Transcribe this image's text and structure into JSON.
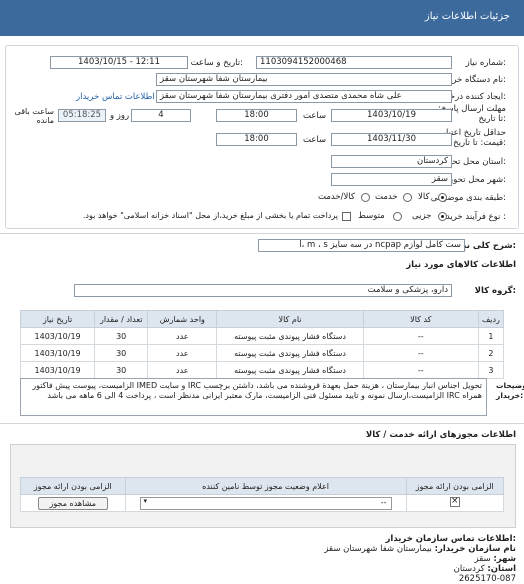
{
  "header": {
    "title": "جزئیات اطلاعات نیاز"
  },
  "form": {
    "need_number_label": "شماره نیاز:",
    "need_number": "1103094152000468",
    "announce_label": "تاریخ و ساعت اعلان عمومی:",
    "announce_value": "1403/10/15 - 12:11",
    "buyer_label": "نام دستگاه خریدار:",
    "buyer_value": "بیمارستان شفا شهرستان سقز",
    "creator_label": "ایجاد کننده درخواست:",
    "creator_value": "علی شاه محمدی متصدی امور دفتری بیمارستان شفا شهرستان سقز",
    "contact_link": "اطلاعات تماس خریدار",
    "reply_deadline_label": "مهلت ارسال پاسخ: تا تاریخ:",
    "reply_date": "1403/10/19",
    "time_label": "ساعت",
    "reply_time": "18:00",
    "days_value": "4",
    "days_label": "روز و",
    "remaining_time": "05:18:25",
    "remaining_label": "ساعت باقی مانده",
    "validity_label": "حداقل تاریخ اعتبار قیمت: تا تاریخ:",
    "validity_date": "1403/11/30",
    "validity_time": "18:00",
    "province_label": "استان محل تحویل:",
    "province_value": "کردستان",
    "city_label": "شهر محل تحویل:",
    "city_value": "سقز",
    "category_label": "طبقه بندی موضوعی:",
    "category_options": [
      "کالا",
      "خدمت",
      "کالا/خدمت"
    ],
    "category_selected": "کالا",
    "process_label": "نوع فرآیند خرید :",
    "process_options": [
      "جزیی",
      "متوسط"
    ],
    "process_selected": "جزیی",
    "payment_note": "پرداخت تمام یا بخشی از مبلغ خرید،از محل \"اسناد خزانه اسلامی\" خواهد بود."
  },
  "summary": {
    "label": "شرح کلی نیاز:",
    "value": "ست کامل لوازم ncpap در سه سایز l، m ، s"
  },
  "goods": {
    "section_title": "اطلاعات کالاهای مورد نیاز",
    "group_label": "گروه کالا:",
    "group_value": "دارو، پزشکی و سلامت",
    "columns": [
      "ردیف",
      "کد کالا",
      "نام کالا",
      "واحد شمارش",
      "تعداد / مقدار",
      "تاریخ نیاز"
    ],
    "rows": [
      {
        "row": "1",
        "code": "--",
        "name": "دستگاه فشار پیوندی مثبت پیوسته",
        "unit": "عدد",
        "qty": "30",
        "date": "1403/10/19"
      },
      {
        "row": "2",
        "code": "--",
        "name": "دستگاه فشار پیوندی مثبت پیوسته",
        "unit": "عدد",
        "qty": "30",
        "date": "1403/10/19"
      },
      {
        "row": "3",
        "code": "--",
        "name": "دستگاه فشار پیوندی مثبت پیوسته",
        "unit": "عدد",
        "qty": "30",
        "date": "1403/10/19"
      }
    ],
    "buyer_notes_label": "توضیحات خریدار:",
    "buyer_notes": "تحویل اجناس انبار بیمارستان ، هزینة حمل بعهدة فروشنده می باشد، داشتن برچسب IRC و سایت IMED الزامیست، پیوست پیش فاکتور همراه IRC الزامیست،ارسال نمونه و تایید مسئول فنی الزامیست، مارک معتبر ایرانی مدنظر است ، پرداخت 4 الی 6 ماهه می باشد"
  },
  "permits": {
    "section_title": "اطلاعات مجوزهای ارائه خدمت / کالا",
    "columns": [
      "الزامی بودن ارائه مجوز",
      "اعلام وضعیت مجوز توسط نامین کننده",
      "الزامی بودن ارائه مجوز"
    ],
    "select_value": "--",
    "view_button": "مشاهده مجوز"
  },
  "contact": {
    "section_title": "اطلاعات تماس سازمان خریدار:",
    "org_label": "نام سازمان خریدار:",
    "org_value": "بیمارستان شفا شهرستان سقز",
    "city_label": "شهر:",
    "city_value": "سقز",
    "province_label": "استان:",
    "province_value": "کردستان",
    "phone_value": "2625170-087"
  }
}
